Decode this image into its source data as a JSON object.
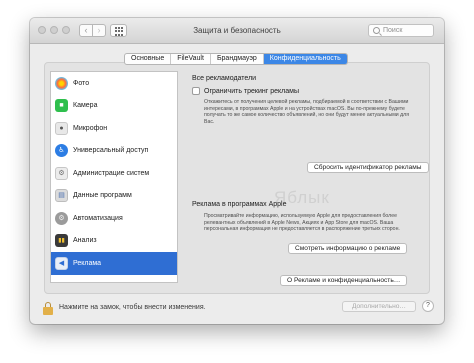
{
  "window": {
    "title": "Защита и безопасность",
    "search_placeholder": "Поиск",
    "nav_back": "‹",
    "nav_forward": "›"
  },
  "tabs": [
    {
      "label": "Основные",
      "active": false
    },
    {
      "label": "FileVault",
      "active": false
    },
    {
      "label": "Брандмауэр",
      "active": false
    },
    {
      "label": "Конфиденциальность",
      "active": true
    }
  ],
  "sidebar": {
    "items": [
      {
        "label": "Фото",
        "icon": "photos-icon",
        "glyph": ""
      },
      {
        "label": "Камера",
        "icon": "camera-icon",
        "glyph": "■"
      },
      {
        "label": "Микрофон",
        "icon": "microphone-icon",
        "glyph": "●"
      },
      {
        "label": "Универсальный доступ",
        "icon": "accessibility-icon",
        "glyph": "♿"
      },
      {
        "label": "Администрацие систем",
        "icon": "admin-icon",
        "glyph": "⚙"
      },
      {
        "label": "Данные программ",
        "icon": "app-data-icon",
        "glyph": "▤"
      },
      {
        "label": "Автоматизация",
        "icon": "automation-icon",
        "glyph": "⚙"
      },
      {
        "label": "Анализ",
        "icon": "analysis-icon",
        "glyph": "▮▮"
      },
      {
        "label": "Реклама",
        "icon": "advertising-icon",
        "glyph": "◀",
        "selected": true
      }
    ]
  },
  "content": {
    "all_ads_title": "Все рекламодатели",
    "limit_tracking_label": "Ограничить трекинг рекламы",
    "limit_tracking_desc": "Откажитесь от получения целевой рекламы, подбираемой в соответствии с Вашими интересами, в программах Apple и на устройствах macOS. Вы по-прежнему будете получать то же самое количество объявлений, но они будут менее актуальными для Вас.",
    "reset_button": "Сбросить идентификатор рекламы",
    "apple_ads_title": "Реклама в программах Apple",
    "apple_ads_desc": "Просматривайте информацию, используемую Apple для предоставления более релевантных объявлений в Apple News, Акциях и App Store для macOS. Ваша персональная информация не предоставляется в распоряжение третьих сторон.",
    "show_info_button": "Смотреть информацию о рекламе",
    "about_button": "О Рекламе и конфиденциальность…",
    "watermark": "Яблык"
  },
  "footer": {
    "lock_text": "Нажмите на замок, чтобы внести изменения.",
    "more_button": "Дополнительно…",
    "help": "?"
  }
}
